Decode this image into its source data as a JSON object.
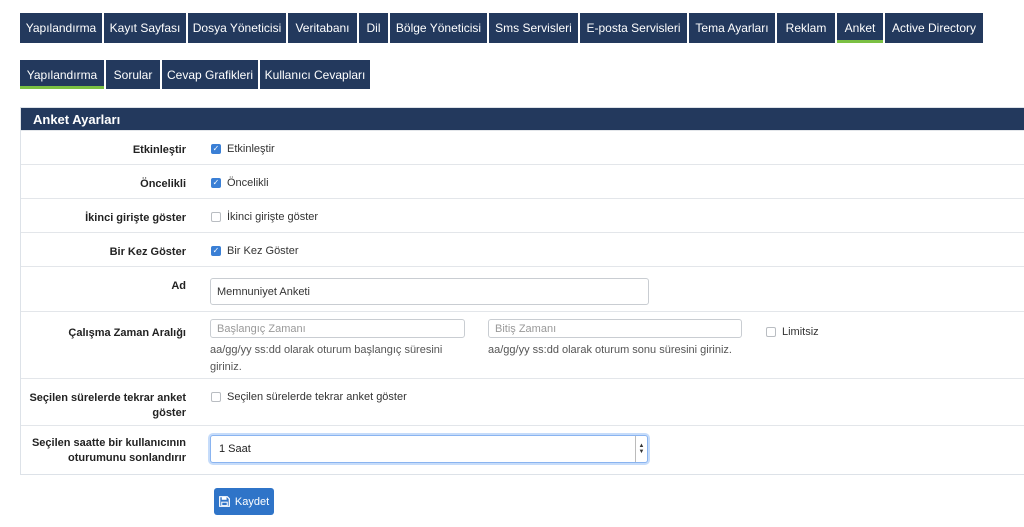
{
  "top_tabs": [
    {
      "label": "Yapılandırma",
      "active": false
    },
    {
      "label": "Kayıt Sayfası",
      "active": false
    },
    {
      "label": "Dosya Yöneticisi",
      "active": false
    },
    {
      "label": "Veritabanı",
      "active": false
    },
    {
      "label": "Dil",
      "active": false
    },
    {
      "label": "Bölge Yöneticisi",
      "active": false
    },
    {
      "label": "Sms Servisleri",
      "active": false
    },
    {
      "label": "E-posta Servisleri",
      "active": false
    },
    {
      "label": "Tema Ayarları",
      "active": false
    },
    {
      "label": "Reklam",
      "active": false
    },
    {
      "label": "Anket",
      "active": true
    },
    {
      "label": "Active Directory",
      "active": false
    }
  ],
  "sub_tabs": [
    {
      "label": "Yapılandırma",
      "active": true
    },
    {
      "label": "Sorular",
      "active": false
    },
    {
      "label": "Cevap Grafikleri",
      "active": false
    },
    {
      "label": "Kullanıcı Cevapları",
      "active": false
    }
  ],
  "panel": {
    "title": "Anket Ayarları",
    "enable": {
      "label": "Etkinleştir",
      "checkbox_label": "Etkinleştir",
      "checked": true
    },
    "priority": {
      "label": "Öncelikli",
      "checkbox_label": "Öncelikli",
      "checked": true
    },
    "second_login": {
      "label": "İkinci girişte göster",
      "checkbox_label": "İkinci girişte göster",
      "checked": false
    },
    "show_once": {
      "label": "Bir Kez Göster",
      "checkbox_label": "Bir Kez Göster",
      "checked": true
    },
    "name": {
      "label": "Ad",
      "value": "Memnuniyet Anketi"
    },
    "time_range": {
      "label": "Çalışma Zaman Aralığı",
      "start_placeholder": "Başlangıç Zamanı",
      "start_hint": "aa/gg/yy ss:dd olarak oturum başlangıç süresini giriniz.",
      "end_placeholder": "Bitiş Zamanı",
      "end_hint": "aa/gg/yy ss:dd olarak oturum sonu süresini giriniz.",
      "unlimited_label": "Limitsiz",
      "unlimited_checked": false
    },
    "repeat": {
      "label": "Seçilen sürelerde tekrar anket göster",
      "checkbox_label": "Seçilen sürelerde tekrar anket göster",
      "checked": false
    },
    "session_end": {
      "label": "Seçilen saatte bir kullanıcının oturumunu sonlandırır",
      "selected": "1 Saat"
    }
  },
  "save_label": "Kaydet"
}
